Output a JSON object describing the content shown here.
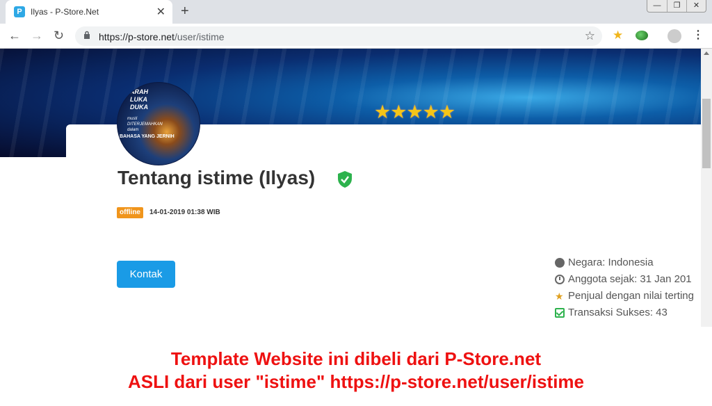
{
  "browser": {
    "tab_title": "Ilyas - P-Store.Net",
    "tab_favicon": "P",
    "url_host": "https://p-store.net",
    "url_path": "/user/istime",
    "new_tab": "+",
    "close": "✕",
    "window_min": "—",
    "window_restore": "❐",
    "window_close": "✕"
  },
  "banner": {
    "rating_stars": "★★★★★",
    "rating_value": 5
  },
  "avatar": {
    "line1": "ARAH\nLUKA\nDUKA",
    "line2": "musti\nDITERJEMAHKAN\ndalam",
    "line3": "BAHASA YANG JERNIH"
  },
  "profile": {
    "title": "Tentang istime (Ilyas)",
    "status": "offline",
    "timestamp": "14-01-2019 01:38 WIB",
    "contact_button": "Kontak"
  },
  "info": [
    {
      "icon": "globe-icon",
      "text": "Negara: Indonesia"
    },
    {
      "icon": "clock-icon",
      "text": "Anggota sejak: 31 Jan 201"
    },
    {
      "icon": "medal-icon",
      "text": "Penjual dengan nilai terting"
    },
    {
      "icon": "check-icon",
      "text": "Transaksi Sukses: 43"
    }
  ],
  "watermark": {
    "line1": "Template Website ini dibeli dari P-Store.net",
    "line2": "ASLI dari user \"istime\" https://p-store.net/user/istime"
  },
  "colors": {
    "badge": "#f0951c",
    "button": "#1a9be6",
    "verified": "#2db24d",
    "watermark": "#ee1111"
  }
}
